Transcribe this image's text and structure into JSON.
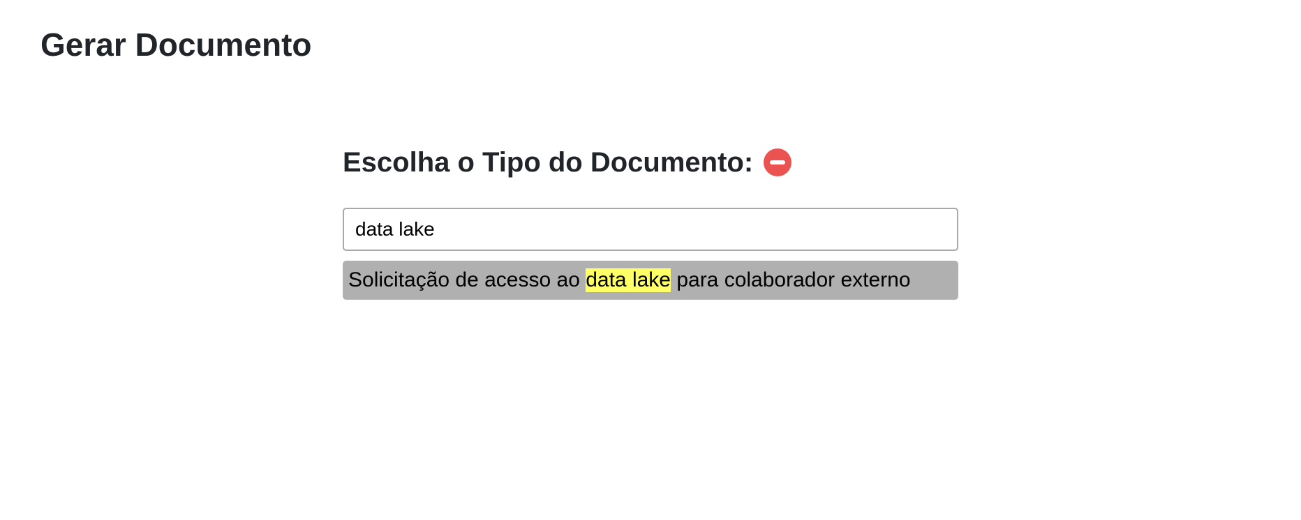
{
  "page": {
    "title": "Gerar Documento"
  },
  "document_type": {
    "heading": "Escolha o Tipo do Documento:",
    "remove_icon": "minus-circle-icon",
    "remove_color": "#ea5350"
  },
  "search": {
    "value": "data lake"
  },
  "suggestions": [
    {
      "prefix": "Solicitação de acesso ao ",
      "match": "data lake",
      "suffix": " para colaborador externo",
      "highlight_color": "#ffff66",
      "background": "#b0b0b0"
    }
  ]
}
